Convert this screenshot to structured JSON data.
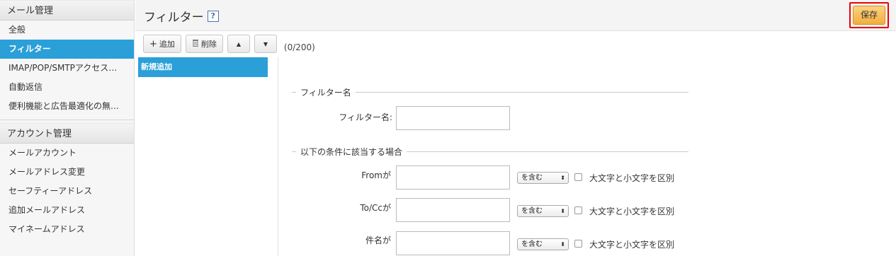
{
  "sidebar": {
    "sections": [
      {
        "header": "メール管理",
        "items": [
          "全般",
          "フィルター",
          "IMAP/POP/SMTPアクセス…",
          "自動返信",
          "便利機能と広告最適化の無…"
        ],
        "active_index": 1
      },
      {
        "header": "アカウント管理",
        "items": [
          "メールアカウント",
          "メールアドレス変更",
          "セーフティーアドレス",
          "追加メールアドレス",
          "マイネームアドレス"
        ]
      }
    ]
  },
  "header": {
    "title": "フィルター",
    "help_icon": "?",
    "save_label": "保存"
  },
  "toolbar": {
    "add_label": "追加",
    "add_icon": "+",
    "delete_label": "削除",
    "delete_icon": "🗑",
    "up_icon": "▲",
    "down_icon": "▼",
    "count": "(0/200)"
  },
  "filters": {
    "items": [
      "新規追加"
    ],
    "selected_index": 0
  },
  "form": {
    "name_section": "フィルター名",
    "name_label": "フィルター名:",
    "name_value": "",
    "conditions_section": "以下の条件に該当する場合",
    "conditions": [
      {
        "label": "Fromが",
        "value": "",
        "operator": "を含む",
        "case_label": "大文字と小文字を区別",
        "case_checked": false
      },
      {
        "label": "To/Ccが",
        "value": "",
        "operator": "を含む",
        "case_label": "大文字と小文字を区別",
        "case_checked": false
      },
      {
        "label": "件名が",
        "value": "",
        "operator": "を含む",
        "case_label": "大文字と小文字を区別",
        "case_checked": false
      }
    ]
  },
  "colors": {
    "accent": "#2a9fd8",
    "save_button": "#f4ad3c",
    "highlight_border": "#e00000"
  }
}
